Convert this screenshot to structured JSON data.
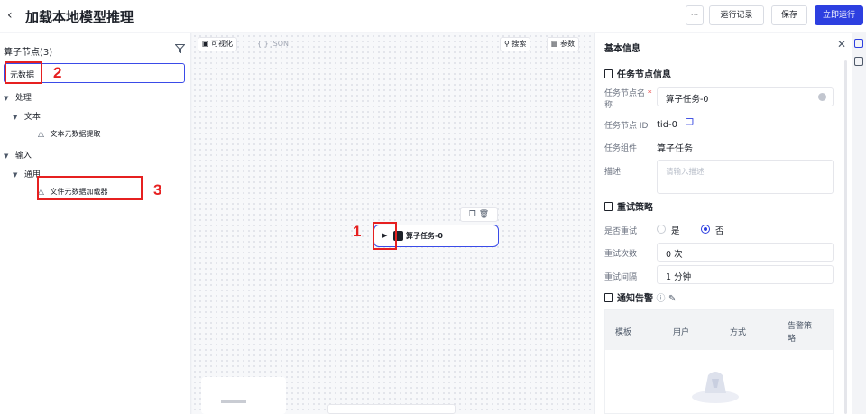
{
  "header": {
    "title": "加载本地模型推理",
    "more_label": "···",
    "run_history_label": "运行记录",
    "save_label": "保存",
    "run_now_label": "立即运行"
  },
  "left_panel": {
    "title": "算子节点(3)",
    "search": {
      "value": "元数据"
    },
    "tree": [
      {
        "label": "处理",
        "level": 0,
        "type": "group"
      },
      {
        "label": "文本",
        "level": 1,
        "type": "group"
      },
      {
        "label": "文本元数据提取",
        "level": 2,
        "type": "leaf"
      },
      {
        "label": "输入",
        "level": 0,
        "type": "group"
      },
      {
        "label": "通用",
        "level": 1,
        "type": "group"
      },
      {
        "label": "文件元数据加载器",
        "level": 2,
        "type": "leaf"
      }
    ]
  },
  "canvas": {
    "visual_tab": "可视化",
    "json_tab": "JSON",
    "search_label": "搜索",
    "params_label": "参数",
    "node": {
      "label": "算子任务-0"
    }
  },
  "annotations": {
    "n1": "1",
    "n2": "2",
    "n3": "3"
  },
  "right_panel": {
    "title": "基本信息",
    "task_section": "任务节点信息",
    "name_label_line1": "任务节点名",
    "name_label_line2": "称",
    "name_required": "*",
    "name_value": "算子任务-0",
    "id_label": "任务节点 ID",
    "id_value": "tid-0",
    "component_label": "任务组件",
    "component_value": "算子任务",
    "desc_label": "描述",
    "desc_placeholder": "请输入描述",
    "retry_section": "重试策略",
    "retry_label": "是否重试",
    "retry_yes": "是",
    "retry_no": "否",
    "retry_count_label": "重试次数",
    "retry_count_value": "0 次",
    "retry_interval_label": "重试间隔",
    "retry_interval_value": "1 分钟",
    "alert_section": "通知告警",
    "table_headers": [
      "模板",
      "用户",
      "方式",
      "告警策",
      "略"
    ]
  },
  "colors": {
    "accent": "#2d3fe0",
    "annotation": "#e62020"
  }
}
